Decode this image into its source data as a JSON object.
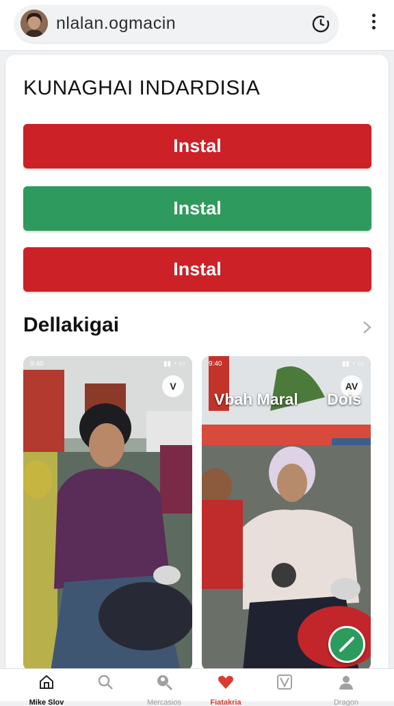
{
  "browser": {
    "url": "nlalan.ogmacin",
    "avatar_icon": "user-avatar",
    "reload_icon": "refresh-icon",
    "menu_icon": "more-vert-icon"
  },
  "main": {
    "heading": "KUNAGHAI INDARDISIA",
    "buttons": [
      {
        "label": "Instal",
        "color": "#cc2127"
      },
      {
        "label": "Instal",
        "color": "#2f9a5d"
      },
      {
        "label": "Instal",
        "color": "#cc2127"
      }
    ],
    "section_title": "Dellakigai",
    "section_icon": "chevron-right-icon"
  },
  "cards": [
    {
      "status_time": "9:40",
      "badge": "V"
    },
    {
      "status_time": "9:40",
      "badge": "AV",
      "overlay_title": "Vbah Maral",
      "overlay_right": "Dois"
    }
  ],
  "nav": [
    {
      "label": "Mike Slov",
      "icon": "home-icon"
    },
    {
      "label": "",
      "icon": "search-icon"
    },
    {
      "label": "Mercasios",
      "icon": "search-person-icon"
    },
    {
      "label": "Fiatakria",
      "icon": "heart-icon",
      "active": true
    },
    {
      "label": "",
      "icon": "check-icon"
    },
    {
      "label": "Dragon",
      "icon": "profile-icon"
    }
  ],
  "colors": {
    "accent_red": "#cc2127",
    "accent_green": "#2f9a5d",
    "nav_active": "#e03a2e"
  }
}
